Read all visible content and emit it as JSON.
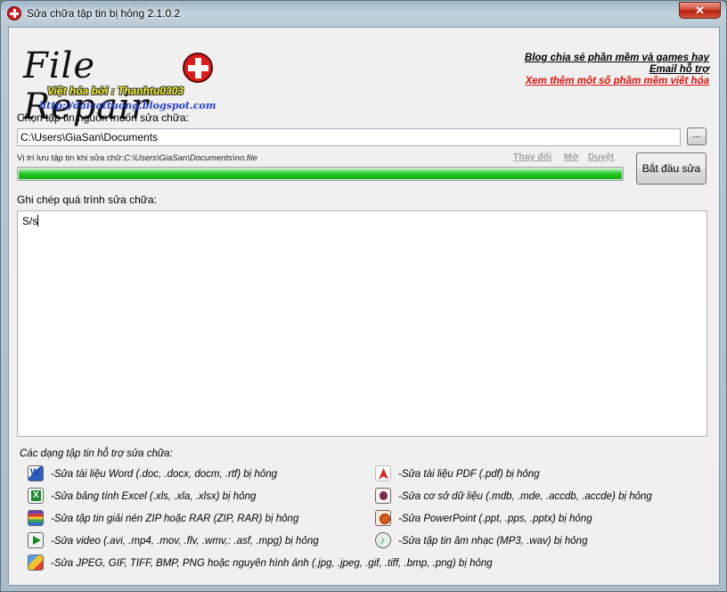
{
  "window": {
    "title": "Sửa chữa tập tin bị hỏng  2.1.0.2",
    "close_label": "✕"
  },
  "logo": {
    "title": "File Repair",
    "subtitle": "Việt hóa bởi : Thanhtu0303",
    "url": "http://daicattuong.blogspot.com"
  },
  "links": {
    "blog": "Blog chia sẻ phần mềm và games hay",
    "email": "Email hỗ trợ",
    "more": "Xem thêm một số phầm mềm việt hóa"
  },
  "source": {
    "label": "Chọn tập tin nguồn muốn sửa chữa:",
    "value": "C:\\Users\\GiaSan\\Documents",
    "browse_label": "..."
  },
  "save": {
    "label": "Vị trí lưu tập tin khi sửa chữ:",
    "path": "C:\\Users\\GiaSan\\Documents\\no.file",
    "change": "Thay đổi",
    "open": "Mở",
    "browse": "Duyệt"
  },
  "progress": {
    "fraction": 1.0
  },
  "start_button": "Bắt đầu sửa",
  "log": {
    "label": "Ghi chép quá trình sửa chữa:",
    "content": "S/s"
  },
  "supported": {
    "title": "Các dạng tập tin hỗ trợ sửa chữa:",
    "left": [
      {
        "icon": "word-icon",
        "text": "-Sửa tài liệu Word (.doc, .docx, docm, .rtf) bị hỏng"
      },
      {
        "icon": "excel-icon",
        "text": "-Sửa bảng tính Excel (.xls, .xla, .xlsx) bị hỏng"
      },
      {
        "icon": "archive-icon",
        "text": "-Sửa tập tin giải nén ZIP hoặc RAR (ZIP, RAR) bị hỏng"
      },
      {
        "icon": "video-icon",
        "text": "-Sửa  video (.avi, .mp4, .mov, .flv, .wmv,: .asf, .mpg) bị hỏng"
      },
      {
        "icon": "image-icon",
        "text": "-Sửa JPEG, GIF, TIFF, BMP, PNG hoặc nguyên hình ảnh (.jpg, .jpeg, .gif, .tiff, .bmp, .png) bị hỏng"
      }
    ],
    "right": [
      {
        "icon": "pdf-icon",
        "text": "-Sửa tài liệu PDF (.pdf) bị hỏng"
      },
      {
        "icon": "database-icon",
        "text": "-Sửa cơ sở dữ liệu (.mdb, .mde, .accdb, .accde) bị hỏng"
      },
      {
        "icon": "powerpoint-icon",
        "text": "-Sửa PowerPoint (.ppt, .pps, .pptx) bị hỏng"
      },
      {
        "icon": "music-icon",
        "text": "-Sửa tập tin âm nhạc (MP3, .wav) bị hỏng"
      }
    ]
  }
}
